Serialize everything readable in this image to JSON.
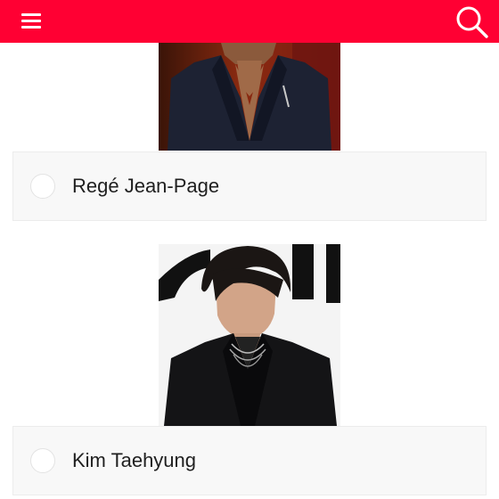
{
  "header": {
    "background_color": "#ff0033",
    "menu_icon": "hamburger-menu-icon",
    "search_icon": "search-icon"
  },
  "options": [
    {
      "label": "Regé Jean-Page",
      "selected": false
    },
    {
      "label": "Kim Taehyung",
      "selected": false
    }
  ]
}
